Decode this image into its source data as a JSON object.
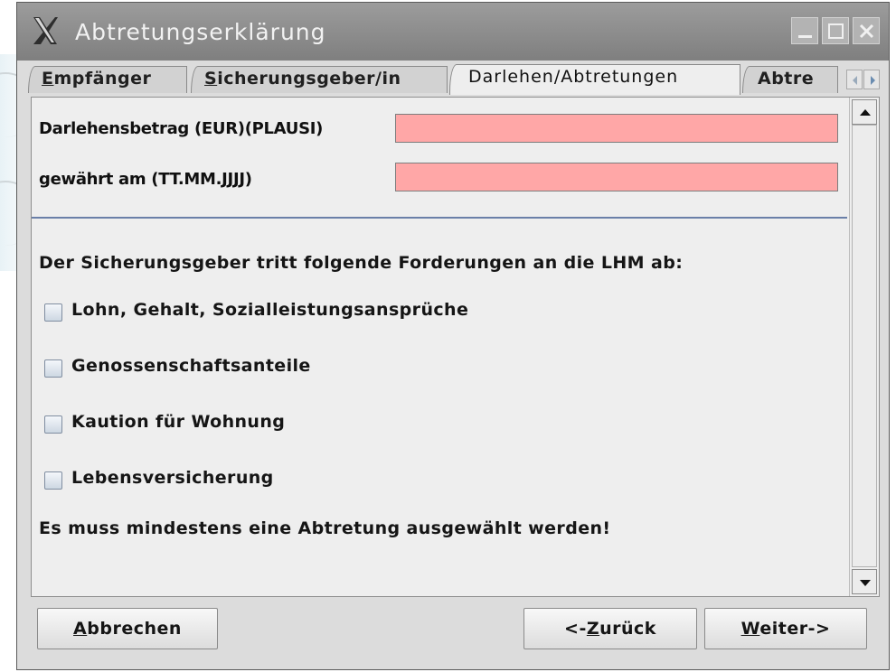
{
  "window": {
    "title": "Abtretungserklärung"
  },
  "tabs": [
    {
      "label": "Empfänger",
      "mnemonic": "E",
      "rest": "mpfänger",
      "active": false
    },
    {
      "label": "Sicherungsgeber/in",
      "mnemonic": "S",
      "rest": "icherungsgeber/in",
      "active": false
    },
    {
      "label": "Darlehen/Abtretungen",
      "active": true
    },
    {
      "label": "Abtre",
      "active": false
    }
  ],
  "form": {
    "amount_label": "Darlehensbetrag (EUR)(PLAUSI)",
    "amount_value": "",
    "date_label": "gewährt am (TT.MM.JJJJ)",
    "date_value": "",
    "invalid_color": "#ffa7a7"
  },
  "claims": {
    "heading": "Der Sicherungsgeber tritt folgende Forderungen an die LHM ab:",
    "options": [
      {
        "label": "Lohn, Gehalt, Sozialleistungsansprüche",
        "checked": false
      },
      {
        "label": "Genossenschaftsanteile",
        "checked": false
      },
      {
        "label": "Kaution für Wohnung",
        "checked": false
      },
      {
        "label": "Lebensversicherung",
        "checked": false
      }
    ],
    "validation_message": "Es muss mindestens eine Abtretung ausgewählt werden!"
  },
  "buttons": {
    "cancel": {
      "label": "Abbrechen",
      "mnemonic": "A",
      "rest": "bbrechen"
    },
    "back": {
      "label": "<-Zurück",
      "prefix": "<-",
      "mnemonic": "Z",
      "rest": "urück"
    },
    "next": {
      "label": "Weiter->",
      "mnemonic": "W",
      "rest": "eiter->"
    }
  },
  "icons": {
    "app": "x-logo-icon",
    "minimize": "minimize-icon",
    "maximize": "maximize-icon",
    "close": "close-icon",
    "tab_scroll_left": "arrow-left-icon",
    "tab_scroll_right": "arrow-right-icon",
    "scroll_up": "arrow-up-icon",
    "scroll_down": "arrow-down-icon"
  }
}
